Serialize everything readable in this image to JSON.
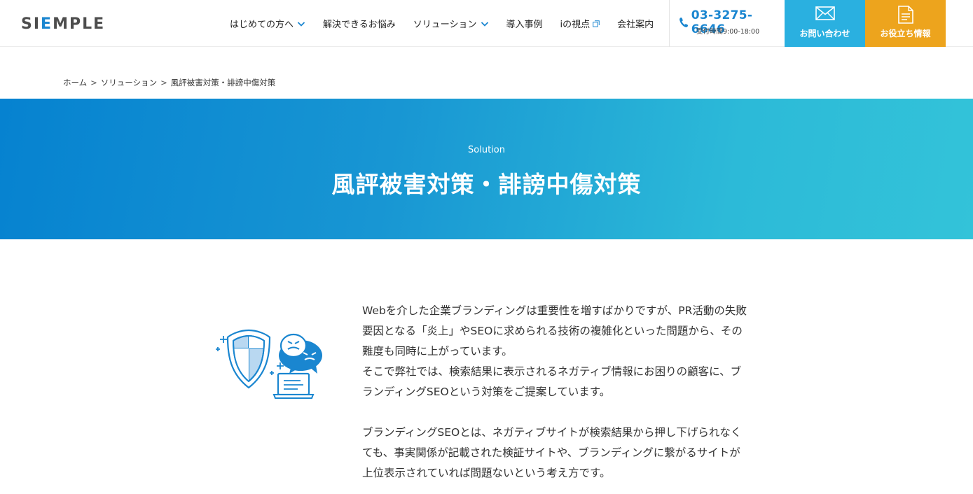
{
  "header": {
    "logo": {
      "pre": "SI",
      "accent": "E",
      "post": "MPLE"
    },
    "nav": [
      {
        "label": "はじめての方へ",
        "has_dropdown": true,
        "external": false
      },
      {
        "label": "解決できるお悩み",
        "has_dropdown": false,
        "external": false
      },
      {
        "label": "ソリューション",
        "has_dropdown": true,
        "external": false
      },
      {
        "label": "導入事例",
        "has_dropdown": false,
        "external": false
      },
      {
        "label": "iの視点",
        "has_dropdown": false,
        "external": true
      },
      {
        "label": "会社案内",
        "has_dropdown": false,
        "external": false
      }
    ],
    "phone": {
      "number": "03-3275-6646",
      "hours": "受付時間9:00-18:00",
      "icon": "phone-icon"
    },
    "contact_button": {
      "label": "お問い合わせ",
      "icon": "envelope-icon",
      "color": "#2ab0e0"
    },
    "info_button": {
      "label": "お役立ち情報",
      "icon": "document-icon",
      "color": "#eda41d"
    }
  },
  "breadcrumb": [
    {
      "label": "ホーム",
      "link": true
    },
    {
      "label": "ソリューション",
      "link": true
    },
    {
      "label": "風評被害対策・誹謗中傷対策",
      "link": false
    }
  ],
  "hero": {
    "eyebrow": "Solution",
    "title": "風評被害対策・誹謗中傷対策",
    "gradient": [
      "#0682d0",
      "#33c3d9"
    ]
  },
  "content": {
    "illustration": "shield-laptop-illustration",
    "paragraphs": [
      [
        "Webを介した企業ブランディングは重要性を増すばかりですが、PR活動の失敗",
        "要因となる「炎上」やSEOに求められる技術の複雑化といった問題から、その",
        "難度も同時に上がっています。",
        "そこで弊社では、検索結果に表示されるネガティブ情報にお困りの顧客に、ブ",
        "ランディングSEOという対策をご提案しています。"
      ],
      [
        "ブランディングSEOとは、ネガティブサイトが検索結果から押し下げられなく",
        "ても、事実関係が記載された検証サイトや、ブランディングに繋がるサイトが",
        "上位表示されていれば問題ないという考え方です。"
      ]
    ]
  },
  "colors": {
    "accent": "#1a86d0",
    "text": "#333333"
  }
}
